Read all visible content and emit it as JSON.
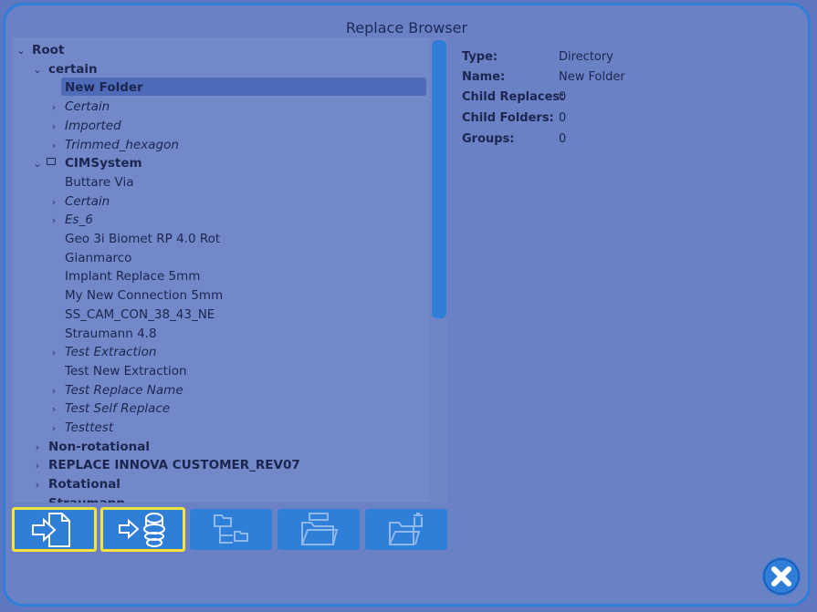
{
  "window": {
    "title": "Replace Browser"
  },
  "tree": {
    "items": [
      {
        "label": "Root",
        "style": "bold",
        "arrow": "expanded"
      },
      {
        "label": "certain",
        "style": "bold",
        "arrow": "expanded"
      },
      {
        "label": "New Folder",
        "style": "bold",
        "arrow": "none",
        "selected": true
      },
      {
        "label": "Certain",
        "style": "italic",
        "arrow": "collapsed"
      },
      {
        "label": "Imported",
        "style": "italic",
        "arrow": "collapsed"
      },
      {
        "label": "Trimmed_hexagon",
        "style": "italic",
        "arrow": "collapsed"
      },
      {
        "label": "CIMSystem",
        "style": "bold",
        "arrow": "expanded",
        "lock": true
      },
      {
        "label": "Buttare Via",
        "style": "normal",
        "arrow": "none"
      },
      {
        "label": "Certain",
        "style": "italic",
        "arrow": "collapsed"
      },
      {
        "label": "Es_6",
        "style": "italic",
        "arrow": "collapsed"
      },
      {
        "label": "Geo 3i Biomet RP 4.0 Rot",
        "style": "normal",
        "arrow": "none"
      },
      {
        "label": "Gianmarco",
        "style": "normal",
        "arrow": "none"
      },
      {
        "label": "Implant Replace 5mm",
        "style": "normal",
        "arrow": "none"
      },
      {
        "label": "My New Connection 5mm",
        "style": "normal",
        "arrow": "none"
      },
      {
        "label": "SS_CAM_CON_38_43_NE",
        "style": "normal",
        "arrow": "none"
      },
      {
        "label": "Straumann 4.8",
        "style": "normal",
        "arrow": "none"
      },
      {
        "label": "Test Extraction",
        "style": "italic",
        "arrow": "collapsed"
      },
      {
        "label": "Test New Extraction",
        "style": "normal",
        "arrow": "none"
      },
      {
        "label": "Test Replace Name",
        "style": "italic",
        "arrow": "collapsed"
      },
      {
        "label": "Test Self Replace",
        "style": "italic",
        "arrow": "collapsed"
      },
      {
        "label": "Testtest",
        "style": "italic",
        "arrow": "collapsed"
      },
      {
        "label": "Non-rotational",
        "style": "bold",
        "arrow": "collapsed"
      },
      {
        "label": "REPLACE INNOVA CUSTOMER_REV07",
        "style": "bold",
        "arrow": "collapsed"
      },
      {
        "label": "Rotational",
        "style": "bold",
        "arrow": "collapsed"
      },
      {
        "label": "Straumann",
        "style": "bold",
        "arrow": "collapsed"
      }
    ]
  },
  "details": {
    "type_key": "Type:",
    "type_val": "Directory",
    "name_key": "Name:",
    "name_val": "New Folder",
    "child_replaces_key": "Child Replaces:",
    "child_replaces_val": "0",
    "child_folders_key": "Child Folders:",
    "child_folders_val": "0",
    "groups_key": "Groups:",
    "groups_val": "0"
  },
  "toolbar": {
    "buttons": [
      {
        "name": "import-file-button",
        "icon": "import-file-icon",
        "highlighted": true,
        "enabled": true
      },
      {
        "name": "import-replace-button",
        "icon": "import-replace-icon",
        "highlighted": true,
        "enabled": true
      },
      {
        "name": "new-folder-button",
        "icon": "folder-tree-icon",
        "highlighted": false,
        "enabled": false
      },
      {
        "name": "rename-folder-button",
        "icon": "rename-folder-icon",
        "highlighted": false,
        "enabled": false
      },
      {
        "name": "delete-folder-button",
        "icon": "delete-folder-icon",
        "highlighted": false,
        "enabled": false
      }
    ]
  },
  "colors": {
    "accent": "#2f7ed8",
    "highlight": "#f5e23a",
    "background": "#6b81c5"
  }
}
